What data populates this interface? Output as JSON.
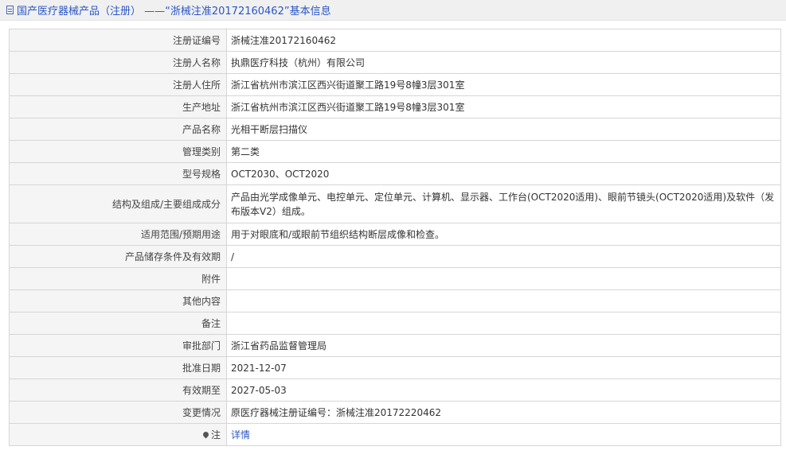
{
  "header": {
    "icon": "document-icon",
    "title": "国产医疗器械产品（注册） ——“浙械注准20172160462”基本信息"
  },
  "rows": [
    {
      "key": "reg_no",
      "label": "注册证编号",
      "value": "浙械注准20172160462"
    },
    {
      "key": "registrant",
      "label": "注册人名称",
      "value": "执鼎医疗科技（杭州）有限公司"
    },
    {
      "key": "registrant_address",
      "label": "注册人住所",
      "value": "浙江省杭州市滨江区西兴街道聚工路19号8幢3层301室"
    },
    {
      "key": "production_address",
      "label": "生产地址",
      "value": "浙江省杭州市滨江区西兴街道聚工路19号8幢3层301室"
    },
    {
      "key": "product_name",
      "label": "产品名称",
      "value": "光相干断层扫描仪"
    },
    {
      "key": "category",
      "label": "管理类别",
      "value": "第二类"
    },
    {
      "key": "model",
      "label": "型号规格",
      "value": "OCT2030、OCT2020"
    },
    {
      "key": "structure",
      "label": "结构及组成/主要组成成分",
      "value": "产品由光学成像单元、电控单元、定位单元、计算机、显示器、工作台(OCT2020适用)、眼前节镜头(OCT2020适用)及软件（发布版本V2）组成。"
    },
    {
      "key": "scope",
      "label": "适用范围/预期用途",
      "value": "用于对眼底和/或眼前节组织结构断层成像和检查。"
    },
    {
      "key": "storage",
      "label": "产品储存条件及有效期",
      "value": "/"
    },
    {
      "key": "attachment",
      "label": "附件",
      "value": ""
    },
    {
      "key": "other",
      "label": "其他内容",
      "value": ""
    },
    {
      "key": "remark",
      "label": "备注",
      "value": ""
    },
    {
      "key": "approval_dept",
      "label": "审批部门",
      "value": "浙江省药品监督管理局"
    },
    {
      "key": "approval_date",
      "label": "批准日期",
      "value": "2021-12-07"
    },
    {
      "key": "valid_until",
      "label": "有效期至",
      "value": "2027-05-03"
    },
    {
      "key": "change",
      "label": "变更情况",
      "value": "原医疗器械注册证编号：浙械注准20172220462"
    },
    {
      "key": "note",
      "label": "注",
      "value": "详情",
      "icon": "pin-icon"
    }
  ]
}
